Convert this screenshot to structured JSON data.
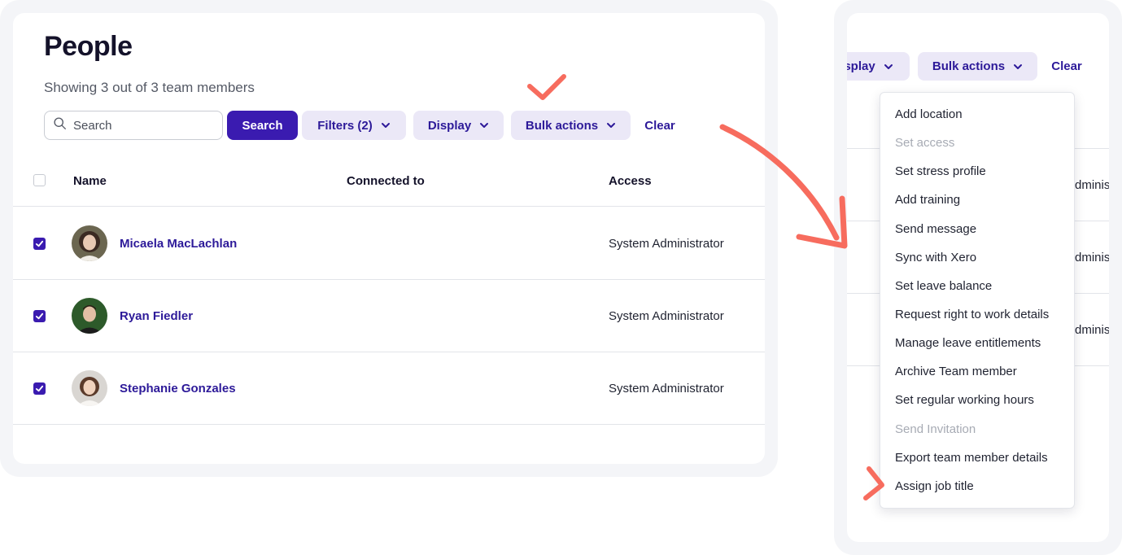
{
  "page": {
    "title": "People",
    "subtitle": "Showing 3 out of 3 team members"
  },
  "toolbar": {
    "search_placeholder": "Search",
    "search_button": "Search",
    "filters_label": "Filters (2)",
    "display_label": "Display",
    "bulk_actions_label": "Bulk actions",
    "clear_label": "Clear"
  },
  "table": {
    "columns": [
      "Name",
      "Connected to",
      "Access"
    ],
    "rows": [
      {
        "name": "Micaela MacLachlan",
        "connected_to": "",
        "access": "System Administrator",
        "selected": true
      },
      {
        "name": "Ryan Fiedler",
        "connected_to": "",
        "access": "System Administrator",
        "selected": true
      },
      {
        "name": "Stephanie Gonzales",
        "connected_to": "",
        "access": "System Administrator",
        "selected": true
      }
    ]
  },
  "zoom_panel": {
    "display_label_partial": "splay",
    "bulk_actions_label": "Bulk actions",
    "clear_label": "Clear",
    "access_partial": "dminist",
    "bulk_menu": [
      {
        "label": "Add location",
        "disabled": false
      },
      {
        "label": "Set access",
        "disabled": true
      },
      {
        "label": "Set stress profile",
        "disabled": false
      },
      {
        "label": "Add training",
        "disabled": false
      },
      {
        "label": "Send message",
        "disabled": false
      },
      {
        "label": "Sync with Xero",
        "disabled": false
      },
      {
        "label": "Set leave balance",
        "disabled": false
      },
      {
        "label": "Request right to work details",
        "disabled": false
      },
      {
        "label": "Manage leave entitlements",
        "disabled": false
      },
      {
        "label": "Archive Team member",
        "disabled": false
      },
      {
        "label": "Set regular working hours",
        "disabled": false
      },
      {
        "label": "Send Invitation",
        "disabled": true
      },
      {
        "label": "Export team member details",
        "disabled": false
      },
      {
        "label": "Assign job title",
        "disabled": false
      }
    ]
  },
  "colors": {
    "accent": "#3a1bb0",
    "accent_text": "#2d1a99",
    "soft_button_bg": "#ebe8f7",
    "annotation": "#f76c5e"
  }
}
